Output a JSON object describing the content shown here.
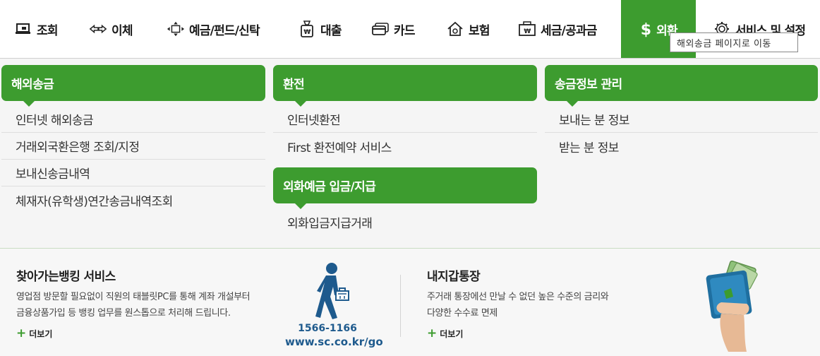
{
  "nav": {
    "items": [
      {
        "label": "조회",
        "icon": "monitor-icon"
      },
      {
        "label": "이체",
        "icon": "transfer-arrows-icon"
      },
      {
        "label": "예금/펀드/신탁",
        "icon": "move-arrows-icon"
      },
      {
        "label": "대출",
        "icon": "money-bag-icon"
      },
      {
        "label": "카드",
        "icon": "card-icon"
      },
      {
        "label": "보험",
        "icon": "house-icon"
      },
      {
        "label": "세금/공과금",
        "icon": "tax-box-icon"
      },
      {
        "label": "외환",
        "icon": "dollar-icon"
      },
      {
        "label": "서비스 및 설정",
        "icon": "gear-icon"
      }
    ],
    "active_index": 7,
    "accent_color": "#3d9c2f"
  },
  "tooltip": "해외송금 페이지로 이동",
  "menu": {
    "columns": [
      {
        "groups": [
          {
            "title": "해외송금",
            "items": [
              "인터넷 해외송금",
              "거래외국환은행 조회/지정",
              "보내신송금내역",
              "체재자(유학생)연간송금내역조회"
            ]
          }
        ]
      },
      {
        "groups": [
          {
            "title": "환전",
            "items": [
              "인터넷환전",
              "First 환전예약 서비스"
            ]
          },
          {
            "title": "외화예금 입금/지급",
            "items": [
              "외화입금지급거래"
            ]
          }
        ]
      },
      {
        "groups": [
          {
            "title": "송금정보 관리",
            "items": [
              "보내는 분 정보",
              "받는 분 정보"
            ]
          }
        ]
      }
    ]
  },
  "promo": {
    "left": {
      "title": "찾아가는뱅킹 서비스",
      "desc_line1": "영업점 방문할 필요없이 직원의 태블릿PC를 통해 계좌 개설부터",
      "desc_line2": "금융상품가입 등 뱅킹 업무를 원스톱으로 처리해 드립니다.",
      "more": "더보기",
      "phone": "1566-1166",
      "url": "www.sc.co.kr/go"
    },
    "right": {
      "title": "내지갑통장",
      "desc_line1": "주거래 통장에선 만날 수 없던 높은 수준의 금리와",
      "desc_line2": "다양한 수수료 면제",
      "more": "더보기"
    }
  }
}
